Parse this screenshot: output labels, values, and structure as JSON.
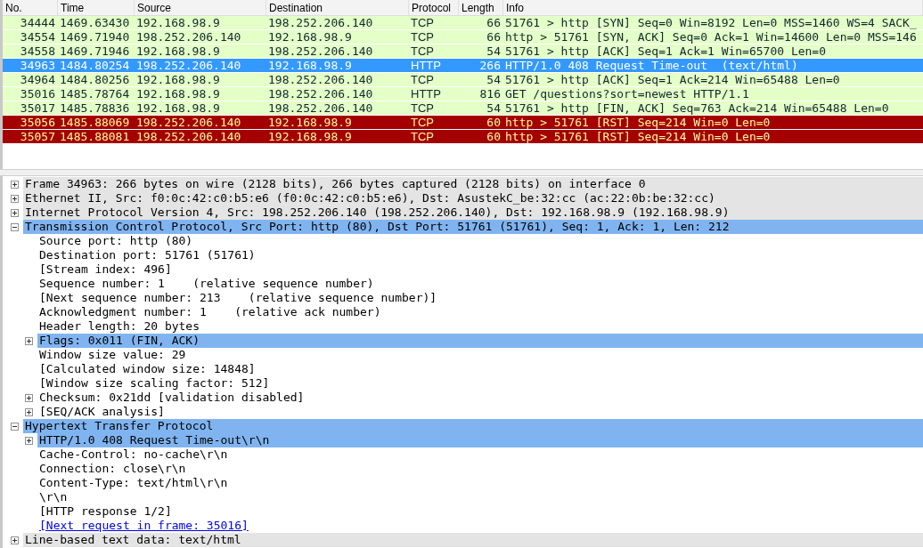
{
  "packet_list": {
    "columns": [
      "No.",
      "Time",
      "Source",
      "Destination",
      "Protocol",
      "Length",
      "Info"
    ],
    "rows": [
      {
        "kind": "normal",
        "selected": false,
        "cells": [
          "34444",
          "1469.63430",
          "192.168.98.9",
          "198.252.206.140",
          "TCP",
          "66",
          "51761 > http [SYN] Seq=0 Win=8192 Len=0 MSS=1460 WS=4 SACK_"
        ]
      },
      {
        "kind": "normal",
        "selected": false,
        "cells": [
          "34554",
          "1469.71940",
          "198.252.206.140",
          "192.168.98.9",
          "TCP",
          "66",
          "http > 51761 [SYN, ACK] Seq=0 Ack=1 Win=14600 Len=0 MSS=146"
        ]
      },
      {
        "kind": "normal",
        "selected": false,
        "cells": [
          "34558",
          "1469.71946",
          "192.168.98.9",
          "198.252.206.140",
          "TCP",
          "54",
          "51761 > http [ACK] Seq=1 Ack=1 Win=65700 Len=0"
        ]
      },
      {
        "kind": "normal",
        "selected": true,
        "cells": [
          "34963",
          "1484.80254",
          "198.252.206.140",
          "192.168.98.9",
          "HTTP",
          "266",
          "HTTP/1.0 408 Request Time-out  (text/html)"
        ]
      },
      {
        "kind": "normal",
        "selected": false,
        "cells": [
          "34964",
          "1484.80256",
          "192.168.98.9",
          "198.252.206.140",
          "TCP",
          "54",
          "51761 > http [ACK] Seq=1 Ack=214 Win=65488 Len=0"
        ]
      },
      {
        "kind": "normal",
        "selected": false,
        "cells": [
          "35016",
          "1485.78764",
          "192.168.98.9",
          "198.252.206.140",
          "HTTP",
          "816",
          "GET /questions?sort=newest HTTP/1.1"
        ]
      },
      {
        "kind": "normal",
        "selected": false,
        "cells": [
          "35017",
          "1485.78836",
          "192.168.98.9",
          "198.252.206.140",
          "TCP",
          "54",
          "51761 > http [FIN, ACK] Seq=763 Ack=214 Win=65488 Len=0"
        ]
      },
      {
        "kind": "reset",
        "selected": false,
        "cells": [
          "35056",
          "1485.88069",
          "198.252.206.140",
          "192.168.98.9",
          "TCP",
          "60",
          "http > 51761 [RST] Seq=214 Win=0 Len=0"
        ]
      },
      {
        "kind": "reset",
        "selected": false,
        "cells": [
          "35057",
          "1485.88081",
          "198.252.206.140",
          "192.168.98.9",
          "TCP",
          "60",
          "http > 51761 [RST] Seq=214 Win=0 Len=0"
        ]
      }
    ]
  },
  "details": [
    {
      "kind": "branch",
      "text": "Frame 34963: 266 bytes on wire (2128 bits), 266 bytes captured (2128 bits) on interface 0",
      "expanded": false,
      "selected": false
    },
    {
      "kind": "branch",
      "text": "Ethernet II, Src: f0:0c:42:c0:b5:e6 (f0:0c:42:c0:b5:e6), Dst: AsustekC_be:32:cc (ac:22:0b:be:32:cc)",
      "expanded": false,
      "selected": false
    },
    {
      "kind": "branch",
      "text": "Internet Protocol Version 4, Src: 198.252.206.140 (198.252.206.140), Dst: 192.168.98.9 (192.168.98.9)",
      "expanded": false,
      "selected": false
    },
    {
      "kind": "branch",
      "text": "Transmission Control Protocol, Src Port: http (80), Dst Port: 51761 (51761), Seq: 1, Ack: 1, Len: 212",
      "expanded": true,
      "selected": true,
      "children": [
        {
          "kind": "leaf",
          "text": "Source port: http (80)",
          "selected": false
        },
        {
          "kind": "leaf",
          "text": "Destination port: 51761 (51761)",
          "selected": false
        },
        {
          "kind": "leaf",
          "text": "[Stream index: 496]",
          "selected": false
        },
        {
          "kind": "leaf",
          "text": "Sequence number: 1    (relative sequence number)",
          "selected": false
        },
        {
          "kind": "leaf",
          "text": "[Next sequence number: 213    (relative sequence number)]",
          "selected": false
        },
        {
          "kind": "leaf",
          "text": "Acknowledgment number: 1    (relative ack number)",
          "selected": false
        },
        {
          "kind": "leaf",
          "text": "Header length: 20 bytes",
          "selected": false
        },
        {
          "kind": "branch",
          "text": "Flags: 0x011 (FIN, ACK)",
          "expanded": false,
          "selected": true
        },
        {
          "kind": "leaf",
          "text": "Window size value: 29",
          "selected": false
        },
        {
          "kind": "leaf",
          "text": "[Calculated window size: 14848]",
          "selected": false
        },
        {
          "kind": "leaf",
          "text": "[Window size scaling factor: 512]",
          "selected": false
        },
        {
          "kind": "branch",
          "text": "Checksum: 0x21dd [validation disabled]",
          "expanded": false,
          "selected": false
        },
        {
          "kind": "branch",
          "text": "[SEQ/ACK analysis]",
          "expanded": false,
          "selected": false
        }
      ]
    },
    {
      "kind": "branch",
      "text": "Hypertext Transfer Protocol",
      "expanded": true,
      "selected": true,
      "children": [
        {
          "kind": "branch",
          "text": "HTTP/1.0 408 Request Time-out\\r\\n",
          "expanded": false,
          "selected": true
        },
        {
          "kind": "leaf",
          "text": "Cache-Control: no-cache\\r\\n",
          "selected": false
        },
        {
          "kind": "leaf",
          "text": "Connection: close\\r\\n",
          "selected": false
        },
        {
          "kind": "leaf",
          "text": "Content-Type: text/html\\r\\n",
          "selected": false
        },
        {
          "kind": "leaf",
          "text": "\\r\\n",
          "selected": false
        },
        {
          "kind": "leaf",
          "text": "[HTTP response 1/2]",
          "selected": false
        },
        {
          "kind": "link",
          "text": "[Next request in frame: 35016]",
          "selected": false
        }
      ]
    },
    {
      "kind": "branch",
      "text": "Line-based text data: text/html",
      "expanded": false,
      "selected": false
    }
  ]
}
